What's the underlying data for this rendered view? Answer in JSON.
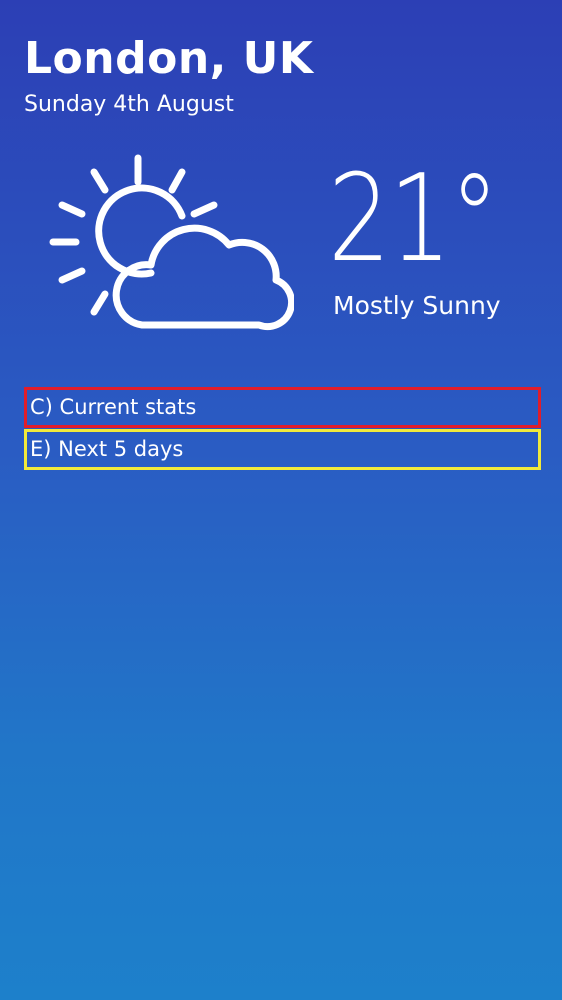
{
  "location": {
    "city": "London, UK",
    "date": "Sunday 4th August"
  },
  "current": {
    "temperature": "21°",
    "condition": "Mostly Sunny",
    "icon": "partly-cloudy-icon"
  },
  "sections": {
    "current_stats": {
      "label": "C) Current stats",
      "border_color": "#e11d2a"
    },
    "next_days": {
      "label": "E) Next 5 days",
      "border_color": "#f2ea3a"
    }
  },
  "colors": {
    "background_top": "#2c3fb5",
    "background_bottom": "#1d80cb",
    "text": "#ffffff"
  }
}
